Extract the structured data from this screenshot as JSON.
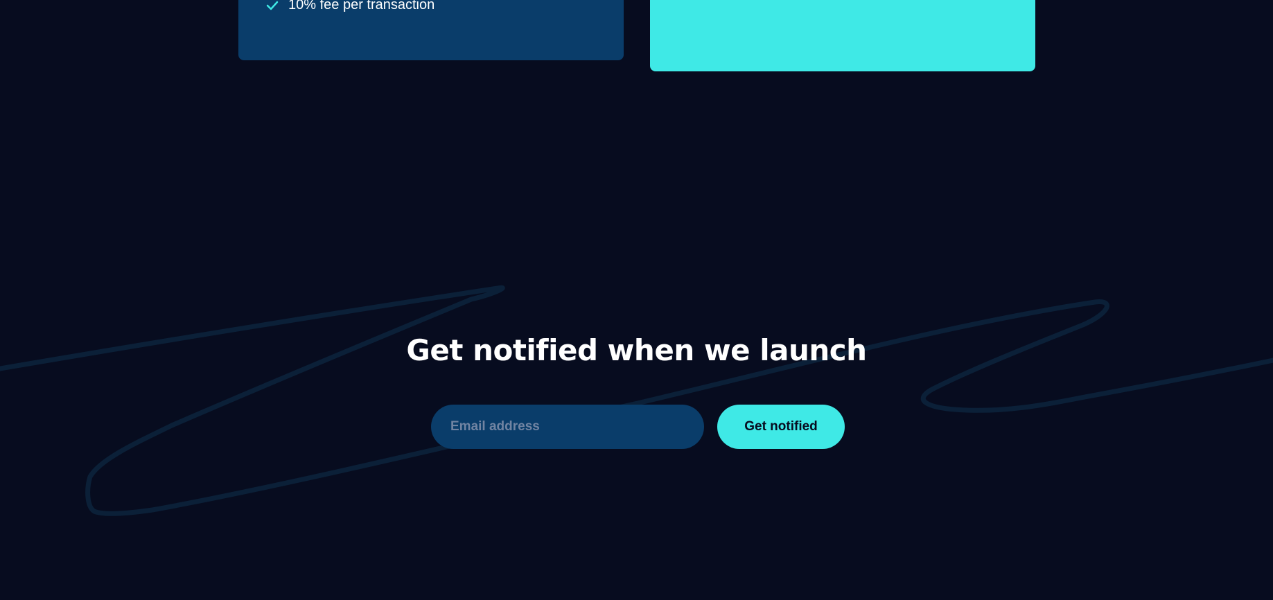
{
  "pricing": {
    "basic_card": {
      "features": [
        {
          "icon": "check-icon",
          "text": "10% fee per transaction"
        }
      ]
    }
  },
  "notify": {
    "title": "Get notified when we launch",
    "email_placeholder": "Email address",
    "button_label": "Get notified"
  },
  "colors": {
    "background": "#070c1f",
    "card_dark": "#0a3d6a",
    "accent": "#3fe9e6",
    "squiggle": "#0b2038"
  }
}
